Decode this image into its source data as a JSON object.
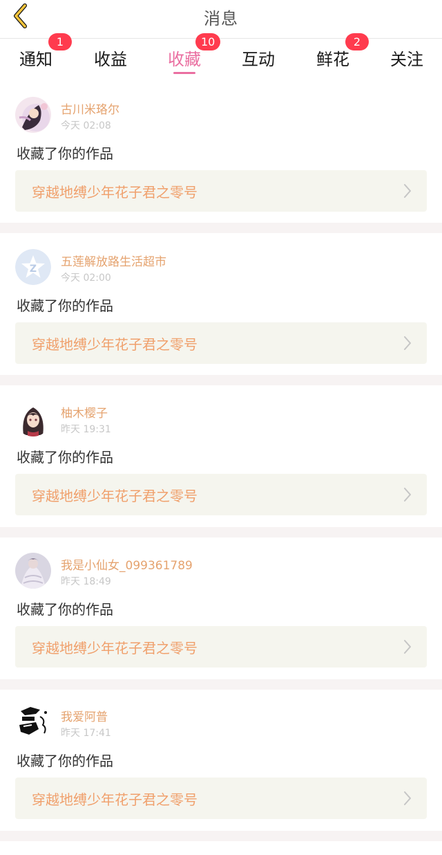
{
  "header": {
    "title": "消息",
    "back_icon": "chevron-left-icon",
    "back_color": "#f3c43a"
  },
  "tabs": [
    {
      "label": "通知",
      "badge": "1",
      "active": false
    },
    {
      "label": "收益",
      "badge": null,
      "active": false
    },
    {
      "label": "收藏",
      "badge": "10",
      "active": true
    },
    {
      "label": "互动",
      "badge": null,
      "active": false
    },
    {
      "label": "鲜花",
      "badge": "2",
      "active": false
    },
    {
      "label": "关注",
      "badge": null,
      "active": false
    }
  ],
  "items": [
    {
      "username": "古川米珞尔",
      "time": "今天 02:08",
      "action": "收藏了你的作品",
      "work_title": "穿越地缚少年花子君之零号",
      "avatar": "anime-girl-avatar"
    },
    {
      "username": "五莲解放路生活超市",
      "time": "今天 02:00",
      "action": "收藏了你的作品",
      "work_title": "穿越地缚少年花子君之零号",
      "avatar": "default-app-avatar"
    },
    {
      "username": "柚木樱子",
      "time": "昨天 19:31",
      "action": "收藏了你的作品",
      "work_title": "穿越地缚少年花子君之零号",
      "avatar": "anime-girl-avatar"
    },
    {
      "username": "我是小仙女_099361789",
      "time": "昨天 18:49",
      "action": "收藏了你的作品",
      "work_title": "穿越地缚少年花子君之零号",
      "avatar": "anime-girl-avatar"
    },
    {
      "username": "我爱阿普",
      "time": "昨天 17:41",
      "action": "收藏了你的作品",
      "work_title": "穿越地缚少年花子君之零号",
      "avatar": "manga-sketch-avatar"
    }
  ],
  "colors": {
    "accent": "#ea6fa1",
    "badge": "#ff3b4e",
    "username": "#e5a36f",
    "work_title": "#f0a06c",
    "work_bg": "#f5f5ee"
  }
}
